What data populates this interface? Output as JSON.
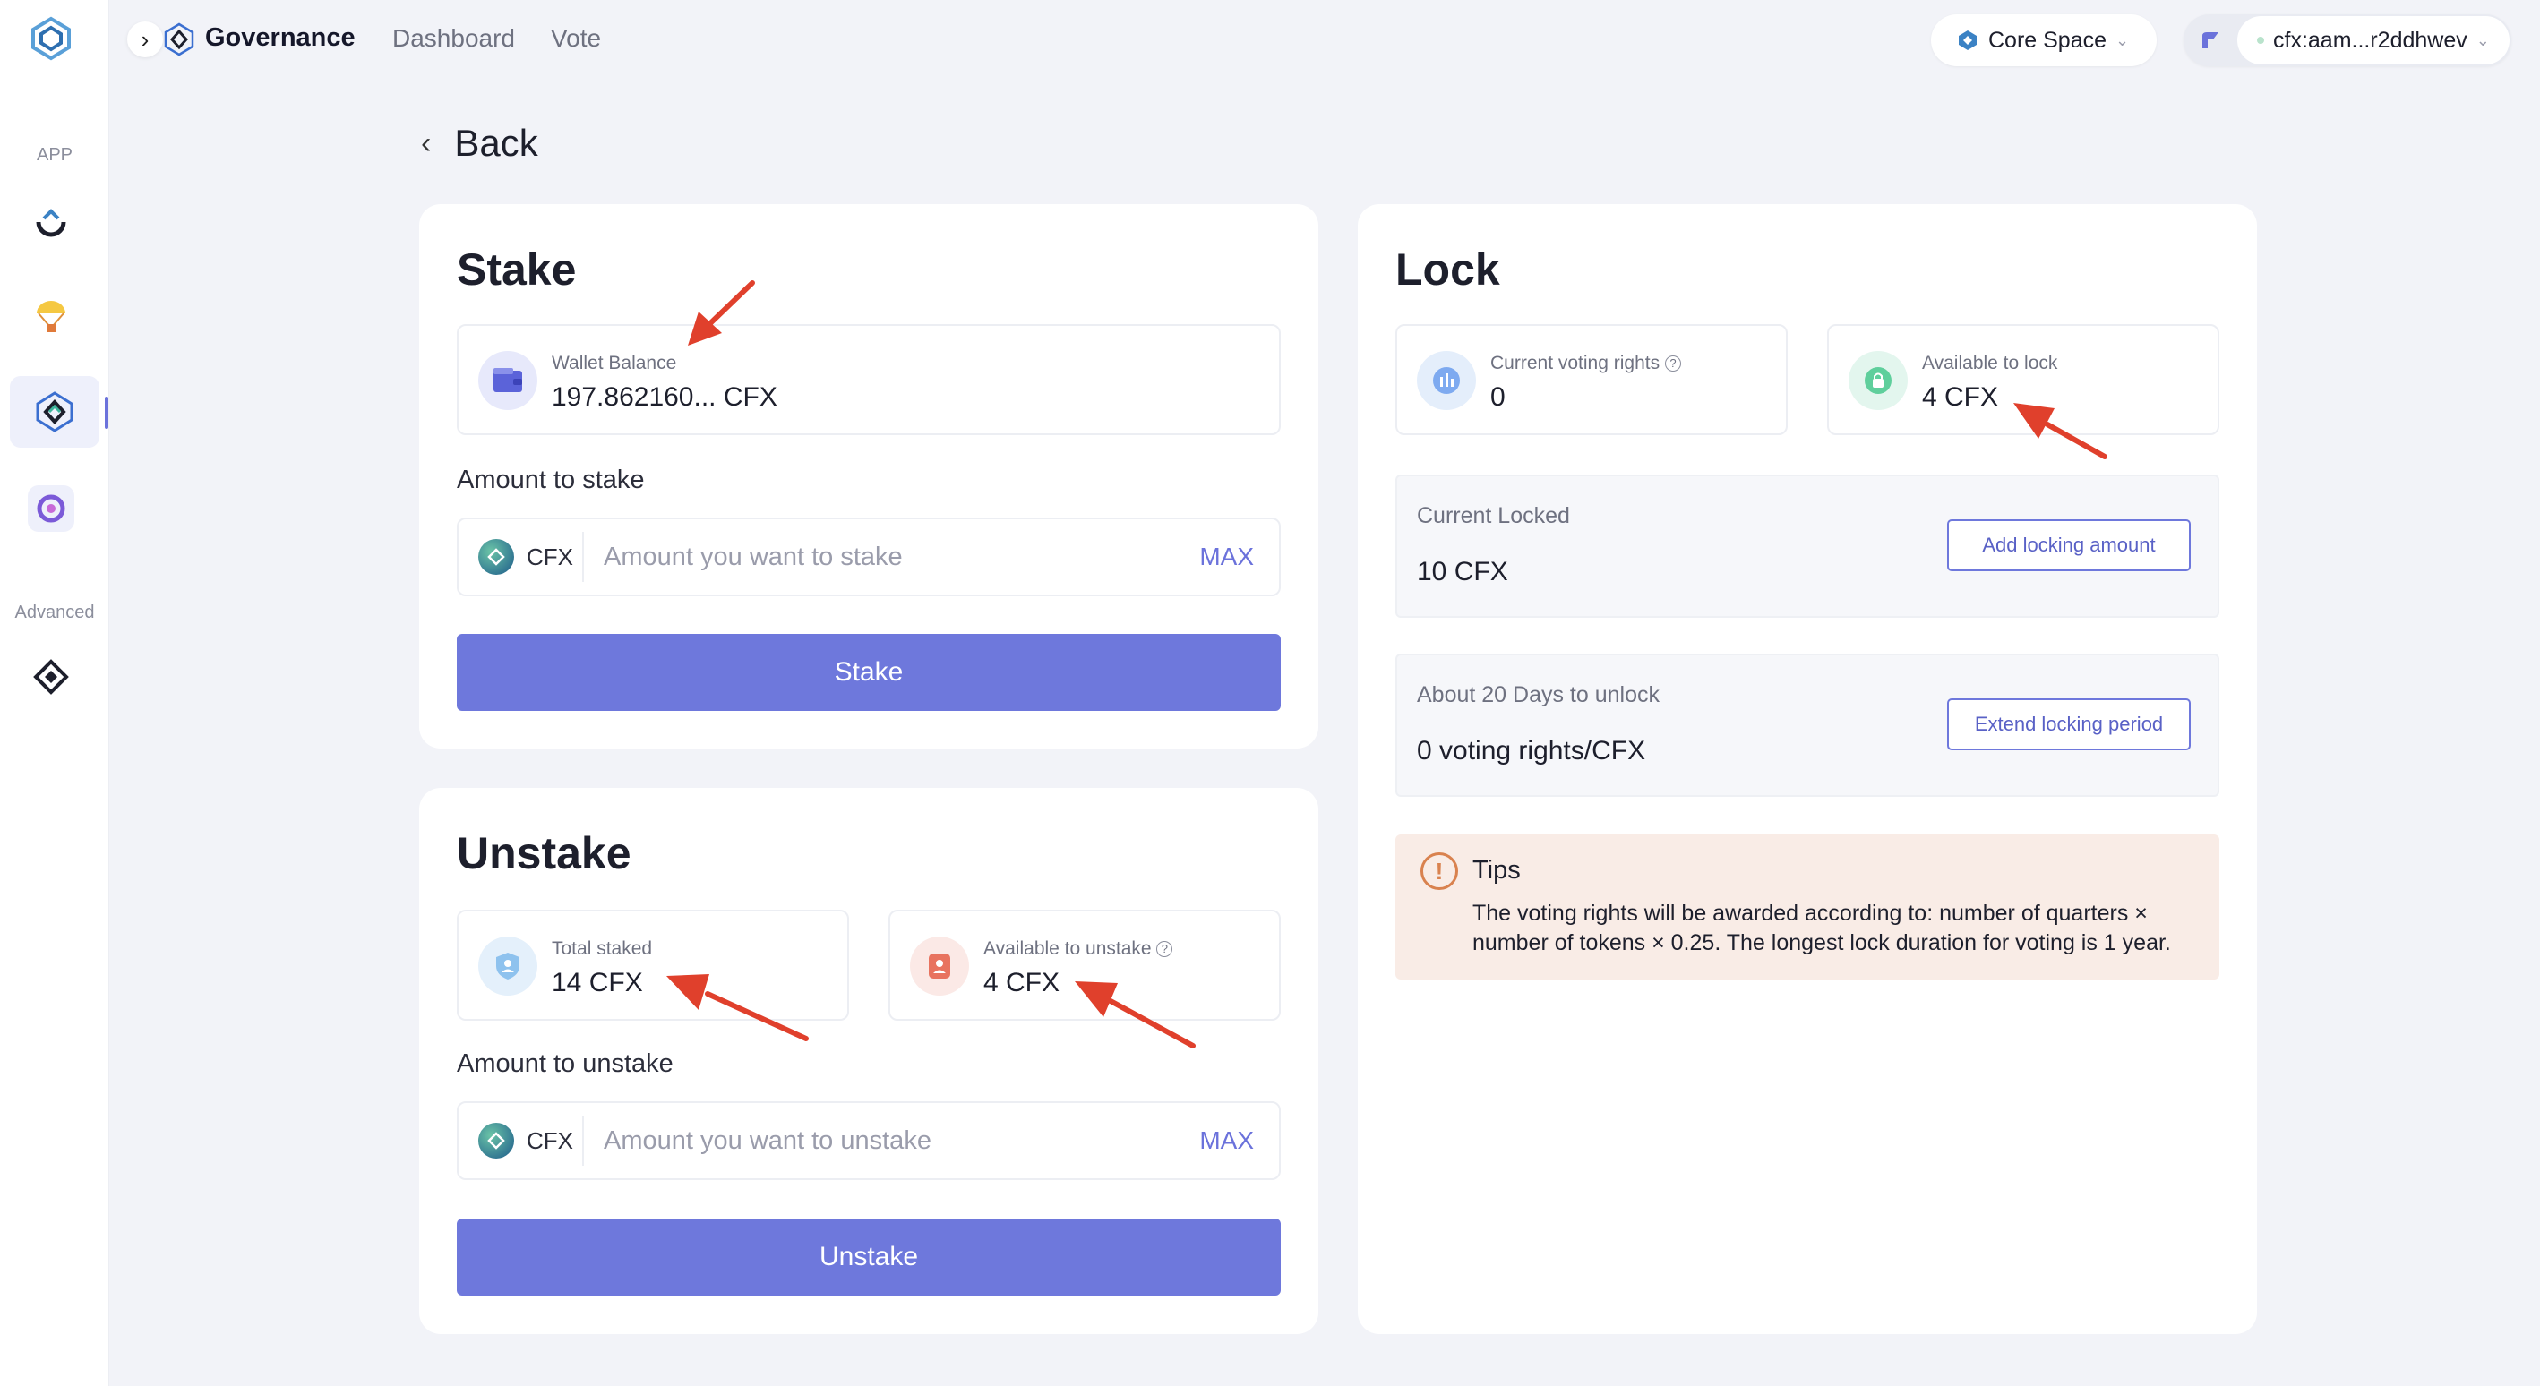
{
  "sidebar": {
    "section_app": "APP",
    "section_advanced": "Advanced"
  },
  "topnav": {
    "title": "Governance",
    "links": [
      "Dashboard",
      "Vote"
    ],
    "network": "Core Space",
    "account": "cfx:aam...r2ddhwev"
  },
  "back_label": "Back",
  "stake": {
    "title": "Stake",
    "wallet_balance_label": "Wallet Balance",
    "wallet_balance_value": "197.862160... CFX",
    "amount_label": "Amount to stake",
    "token": "CFX",
    "placeholder": "Amount you want to stake",
    "max_label": "MAX",
    "button_label": "Stake"
  },
  "unstake": {
    "title": "Unstake",
    "total_staked_label": "Total staked",
    "total_staked_value": "14 CFX",
    "available_label": "Available to unstake",
    "available_value": "4 CFX",
    "amount_label": "Amount to unstake",
    "token": "CFX",
    "placeholder": "Amount you want to unstake",
    "max_label": "MAX",
    "button_label": "Unstake"
  },
  "lock": {
    "title": "Lock",
    "voting_rights_label": "Current voting rights",
    "voting_rights_value": "0",
    "available_label": "Available to lock",
    "available_value": "4 CFX",
    "current_locked_label": "Current Locked",
    "current_locked_value": "10 CFX",
    "add_button": "Add locking amount",
    "unlock_label": "About 20 Days to unlock",
    "unlock_value": "0 voting rights/CFX",
    "extend_button": "Extend locking period",
    "tips_title": "Tips",
    "tips_text": "The voting rights will be awarded according to: number of quarters × number of tokens × 0.25. The longest lock duration for voting is 1 year."
  },
  "colors": {
    "accent": "#6e78dc",
    "annotation": "#e0402c",
    "tips_bg": "#f9ece6"
  }
}
